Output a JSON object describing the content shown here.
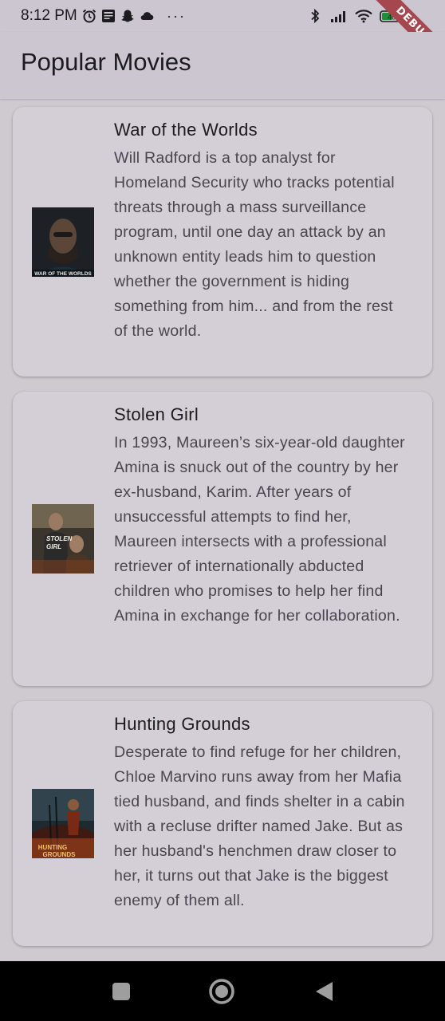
{
  "status_bar": {
    "time": "8:12 PM",
    "left_icons": [
      "alarm-icon",
      "news-icon",
      "snapchat-icon",
      "cloud-icon",
      "more-dots-icon"
    ],
    "right_icons": [
      "bluetooth-icon",
      "signal-icon",
      "wifi-icon",
      "battery-icon"
    ],
    "battery_level": "46",
    "more_label": "···",
    "debug_banner": "DEBUG"
  },
  "app_bar": {
    "title": "Popular Movies"
  },
  "movies": [
    {
      "title": "War of the Worlds",
      "overview": "Will Radford is a top analyst for Homeland Security who tracks potential threats through a mass surveillance program, until one day an attack by an unknown entity leads him to question whether the government is hiding something from him... and from the rest of the world.",
      "poster_text": "WAR OF THE WORLDS"
    },
    {
      "title": "Stolen Girl",
      "overview": "In 1993, Maureen’s six-year-old daughter Amina is snuck out of the country by her ex-husband, Karim. After years of unsuccessful attempts to find her, Maureen intersects with a professional retriever of internationally abducted children who promises to help her find Amina in exchange for her collaboration.",
      "poster_text": "STOLEN GIRL"
    },
    {
      "title": "Hunting Grounds",
      "overview": "Desperate to find refuge for her children, Chloe Marvino runs away from her Mafia tied husband, and finds shelter in a cabin with a recluse drifter named Jake. But as her husband's henchmen draw closer to her, it turns out that Jake is the biggest enemy of them all.",
      "poster_text": "HUNTING GROUNDS"
    }
  ],
  "nav_bar": {
    "buttons": [
      "recents-square-icon",
      "home-circle-icon",
      "back-triangle-icon"
    ]
  },
  "colors": {
    "background": "#cfc9d0",
    "card": "#d4cfd6",
    "debug": "#a6474f"
  }
}
